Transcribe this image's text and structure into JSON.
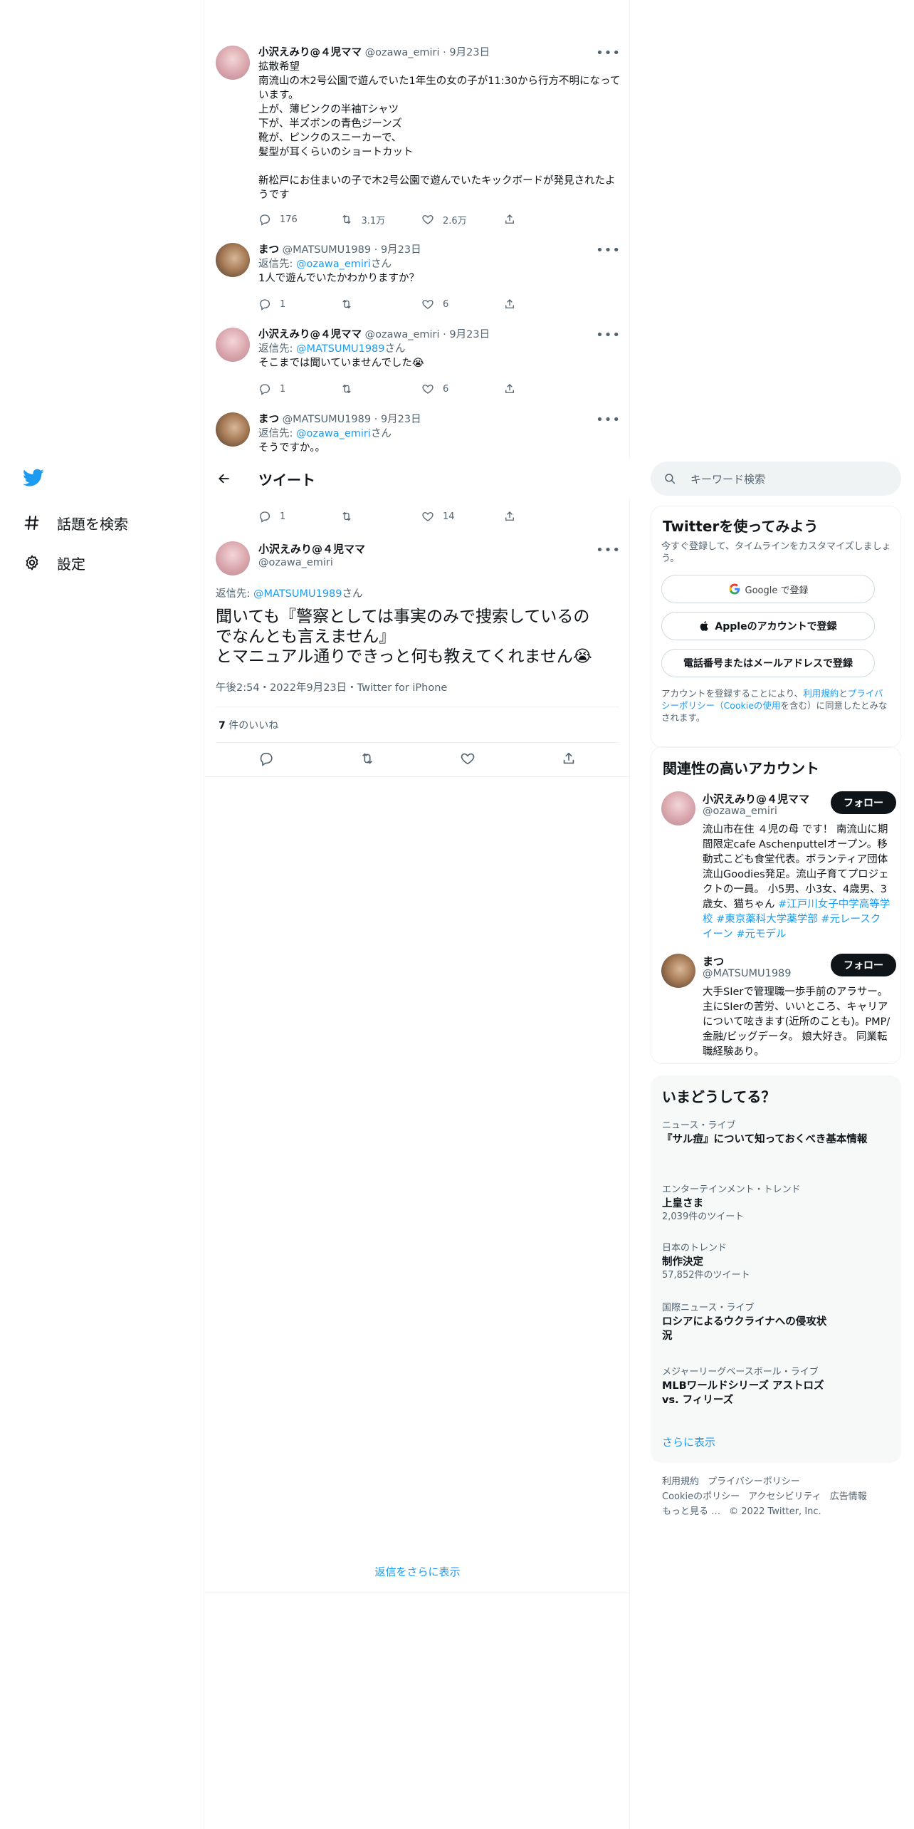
{
  "nav": {
    "explore_label": "話題を検索",
    "settings_label": "設定"
  },
  "header": {
    "title": "ツイート"
  },
  "thread": [
    {
      "name": "小沢えみり@４児ママ",
      "handle": "@ozawa_emiri",
      "date": "· 9月23日",
      "reply_prefix": "",
      "reply_to": "",
      "reply_suffix": "",
      "lines": [
        "拡散希望",
        "南流山の木2号公園で遊んでいた1年生の女の子が11:30から行方不明になっています。",
        "上が、薄ピンクの半袖Tシャツ",
        "下が、半ズボンの青色ジーンズ",
        "靴が、ピンクのスニーカーで、",
        "髪型が耳くらいのショートカット",
        "",
        "新松戸にお住まいの子で木2号公園で遊んでいたキックボードが発見されたようです"
      ],
      "replies": "176",
      "retweets": "3.1万",
      "likes": "2.6万"
    },
    {
      "name": "まつ",
      "handle": "@MATSUMU1989",
      "date": "· 9月23日",
      "reply_prefix": "返信先: ",
      "reply_to": "@ozawa_emiri",
      "reply_suffix": "さん",
      "lines": [
        "1人で遊んでいたかわかりますか？"
      ],
      "replies": "1",
      "retweets": "",
      "likes": "6"
    },
    {
      "name": "小沢えみり@４児ママ",
      "handle": "@ozawa_emiri",
      "date": "· 9月23日",
      "reply_prefix": "返信先: ",
      "reply_to": "@MATSUMU1989",
      "reply_suffix": "さん",
      "lines": [
        "そこまでは聞いていませんでした😭"
      ],
      "replies": "1",
      "retweets": "",
      "likes": "6"
    },
    {
      "name": "まつ",
      "handle": "@MATSUMU1989",
      "date": "· 9月23日",
      "reply_prefix": "返信先: ",
      "reply_to": "@ozawa_emiri",
      "reply_suffix": "さん",
      "lines": [
        "そうですか。。"
      ],
      "replies": "1",
      "retweets": "",
      "likes": "14"
    }
  ],
  "focus": {
    "name": "小沢えみり@４児ママ",
    "handle": "@ozawa_emiri",
    "reply_prefix": "返信先: ",
    "reply_to": "@MATSUMU1989",
    "reply_suffix": "さん",
    "lines": [
      "聞いても『警察としては事実のみで捜索しているの",
      "でなんとも言えません』",
      "とマニュアル通りできっと何も教えてくれません😭"
    ],
    "meta": "午後2:54・2022年9月23日・Twitter for iPhone",
    "likes_count": "7",
    "likes_label": " 件のいいね"
  },
  "show_more_replies": "返信をさらに表示",
  "search": {
    "placeholder": "キーワード検索"
  },
  "signup": {
    "title": "Twitterを使ってみよう",
    "subtitle": "今すぐ登録して、タイムラインをカスタマイズしましょう。",
    "google": "Google で登録",
    "apple": "Appleのアカウントで登録",
    "phone": "電話番号またはメールアドレスで登録",
    "terms_prefix": "アカウントを登録することにより、",
    "terms_link1": "利用規約",
    "terms_mid": "と",
    "terms_link2": "プライバシーポリシー（Cookieの使用",
    "terms_suffix": "を含む）に同意したとみなされます。"
  },
  "related": {
    "title": "関連性の高いアカウント",
    "follow_label": "フォロー",
    "accounts": [
      {
        "name": "小沢えみり@４児ママ",
        "handle": "@ozawa_emiri",
        "bio": "流山市在住 ４児の母 です！ 南流山に期間限定cafe Aschenputtelオープン。移動式こども食堂代表。ボランティア団体流山Goodies発足。流山子育てプロジェクトの一員。 小5男、小3女、4歳男、3歳女、猫ちゃん ",
        "bio_tags": "#江戸川女子中学高等学校 #東京薬科大学薬学部 #元レースクイーン #元モデル"
      },
      {
        "name": "まつ",
        "handle": "@MATSUMU1989",
        "bio": "大手SIerで管理職一歩手前のアラサー。主にSIerの苦労、いいところ、キャリアについて呟きます(近所のことも)。PMP/金融/ビッグデータ。 娘大好き。 同業転職経験あり。",
        "bio_tags": ""
      }
    ]
  },
  "trends": {
    "title": "いまどうしてる？",
    "items": [
      {
        "context": "ニュース・ライブ",
        "title": "『サル痘』について知っておくべき基本情報",
        "count": ""
      },
      {
        "context": "エンターテインメント・トレンド",
        "title": "上皇さま",
        "count": "2,039件のツイート"
      },
      {
        "context": "日本のトレンド",
        "title": "制作決定",
        "count": "57,852件のツイート"
      },
      {
        "context": "国際ニュース・ライブ",
        "title": "ロシアによるウクライナへの侵攻状況",
        "count": ""
      },
      {
        "context": "メジャーリーグベースボール・ライブ",
        "title": "MLBワールドシリーズ アストロズ vs. フィリーズ",
        "count": ""
      }
    ],
    "show_more": "さらに表示"
  },
  "footer": {
    "terms": "利用規約",
    "privacy": "プライバシーポリシー",
    "cookie": "Cookieのポリシー",
    "accessibility": "アクセシビリティ",
    "ads": "広告情報",
    "more": "もっと見る …",
    "copyright": "© 2022 Twitter, Inc."
  },
  "colors": {
    "accent": "#1d9bf0",
    "text": "#0f1419",
    "muted": "#536471",
    "border": "#eff3f4"
  }
}
